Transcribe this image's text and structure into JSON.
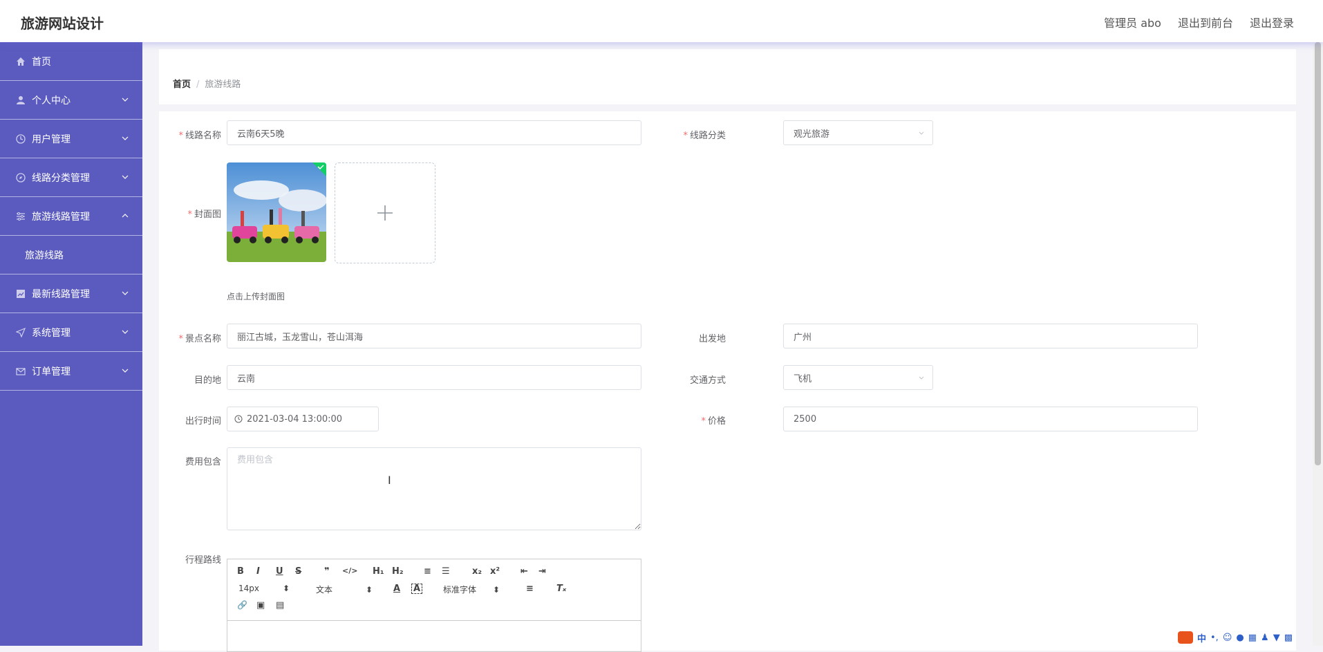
{
  "header": {
    "app_title": "旅游网站设计",
    "admin_label": "管理员 abo",
    "front_link": "退出到前台",
    "logout_link": "退出登录"
  },
  "sidebar": {
    "items": [
      {
        "label": "首页",
        "icon": "home-icon"
      },
      {
        "label": "个人中心",
        "icon": "user-icon"
      },
      {
        "label": "用户管理",
        "icon": "clock-icon"
      },
      {
        "label": "线路分类管理",
        "icon": "compass-icon"
      },
      {
        "label": "旅游线路管理",
        "icon": "sliders-icon",
        "expanded": true
      },
      {
        "label": "旅游线路",
        "sub": true
      },
      {
        "label": "最新线路管理",
        "icon": "chart-icon"
      },
      {
        "label": "系统管理",
        "icon": "send-icon"
      },
      {
        "label": "订单管理",
        "icon": "mail-icon"
      }
    ],
    "bg_color": "#5b5bbf"
  },
  "breadcrumb": {
    "home": "首页",
    "separator": "/",
    "current": "旅游线路"
  },
  "form": {
    "route_name": {
      "label": "线路名称",
      "value": "云南6天5晚"
    },
    "route_category": {
      "label": "线路分类",
      "value": "观光旅游"
    },
    "cover": {
      "label": "封面图",
      "tip": "点击上传封面图"
    },
    "scenic": {
      "label": "景点名称",
      "value": "丽江古城，玉龙雪山，苍山洱海"
    },
    "departure": {
      "label": "出发地",
      "value": "广州"
    },
    "destination": {
      "label": "目的地",
      "value": "云南"
    },
    "transport": {
      "label": "交通方式",
      "value": "飞机"
    },
    "travel_time": {
      "label": "出行时间",
      "value": "2021-03-04 13:00:00"
    },
    "price": {
      "label": "价格",
      "value": "2500"
    },
    "fee_includes": {
      "label": "费用包含",
      "placeholder": "费用包含"
    },
    "itinerary": {
      "label": "行程路线"
    }
  },
  "editor": {
    "font_size": "14px",
    "text_type": "文本",
    "font_family": "标准字体",
    "buttons": {
      "bold": "B",
      "italic": "I",
      "underline": "U",
      "strike": "S",
      "quote": "❞",
      "code": "</>",
      "h1": "H₁",
      "h2": "H₂",
      "ol": "≡",
      "ul": "☰",
      "sub": "x₂",
      "sup": "x²",
      "outdent": "⇤",
      "indent": "⇥",
      "color": "A",
      "bg": "A",
      "align": "≡",
      "clean": "Tₓ",
      "link": "🔗",
      "image": "▣",
      "video": "▤"
    }
  },
  "ime": {
    "label": "中"
  }
}
